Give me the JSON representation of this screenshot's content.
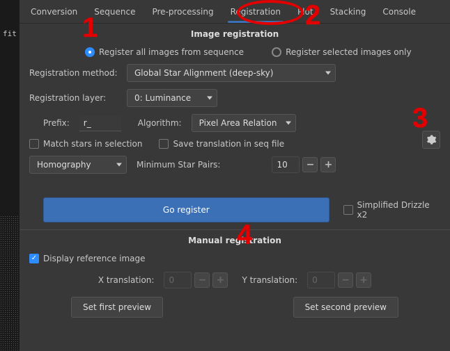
{
  "sidebar_label": "fit",
  "tabs": {
    "items": [
      "Conversion",
      "Sequence",
      "Pre-processing",
      "Registration",
      "Plot",
      "Stacking",
      "Console"
    ],
    "active_index": 3
  },
  "section1_title": "Image registration",
  "radios": {
    "all_label": "Register all images from sequence",
    "selected_label": "Register selected images only",
    "value": "all"
  },
  "reg_method": {
    "label": "Registration method:",
    "value": "Global Star Alignment (deep-sky)"
  },
  "reg_layer": {
    "label": "Registration layer:",
    "value": "0: Luminance"
  },
  "prefix": {
    "label": "Prefix:",
    "value": "r_"
  },
  "algorithm": {
    "label": "Algorithm:",
    "value": "Pixel Area Relation"
  },
  "cb_match_stars": {
    "label": "Match stars in selection",
    "checked": false
  },
  "cb_save_seq": {
    "label": "Save translation in seq file",
    "checked": false
  },
  "transform": {
    "value": "Homography"
  },
  "min_star": {
    "label": "Minimum Star Pairs:",
    "value": "10"
  },
  "go_button": "Go register",
  "cb_drizzle": {
    "label": "Simplified Drizzle x2",
    "checked": false
  },
  "section2_title": "Manual registration",
  "cb_display_ref": {
    "label": "Display reference image",
    "checked": true
  },
  "xtrans": {
    "label": "X translation:",
    "value": "0"
  },
  "ytrans": {
    "label": "Y translation:",
    "value": "0"
  },
  "preview1": "Set first preview",
  "preview2": "Set second preview",
  "annotations": {
    "n1": "1",
    "n2": "2",
    "n3": "3",
    "n4": "4"
  }
}
